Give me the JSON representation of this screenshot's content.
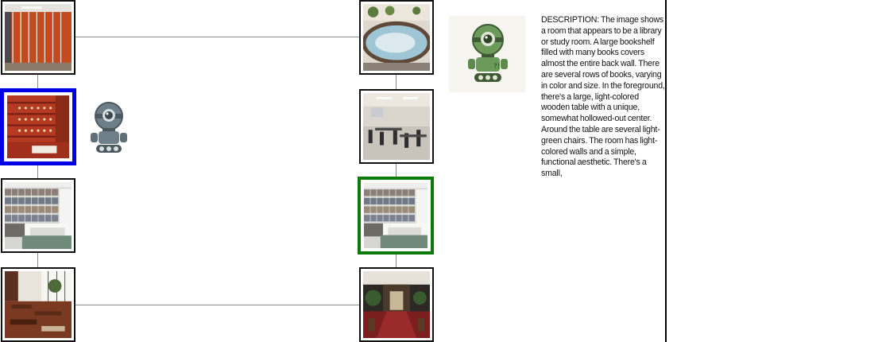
{
  "graph": {
    "nodes": [
      {
        "id": "left-1",
        "scene": "locker room with orange lockers"
      },
      {
        "id": "left-2",
        "scene": "red brick wine cellar shelves",
        "selection": "blue"
      },
      {
        "id": "left-3",
        "scene": "library with bookshelves and white tables"
      },
      {
        "id": "left-4",
        "scene": "cafe dining room with wooden chairs"
      },
      {
        "id": "right-1",
        "scene": "round indoor hot tub"
      },
      {
        "id": "right-2",
        "scene": "classroom with chairs and tables"
      },
      {
        "id": "right-3",
        "scene": "library with bookshelves and white tables",
        "selection": "green"
      },
      {
        "id": "right-4",
        "scene": "ornate hotel lobby with red carpet"
      }
    ]
  },
  "agents": {
    "left_robot_icon": "robot-icon",
    "right_robot_icon": "robot-thinking-icon"
  },
  "description": {
    "text": "DESCRIPTION: The image shows a room that appears to be a library or study room. A large bookshelf filled with many books covers almost the entire back wall. There are several rows of books, varying in color and size. In the foreground, there's a large, light-colored wooden table with a unique, somewhat hollowed-out center. Around the table are several light-green chairs. The room has light-colored walls and a simple, functional aesthetic. There's a small,"
  },
  "colors": {
    "selected_left": "#0000e6",
    "selected_right": "#0a7a0a",
    "robot_left": "#5f6f7a",
    "robot_right": "#6b9a5a"
  }
}
